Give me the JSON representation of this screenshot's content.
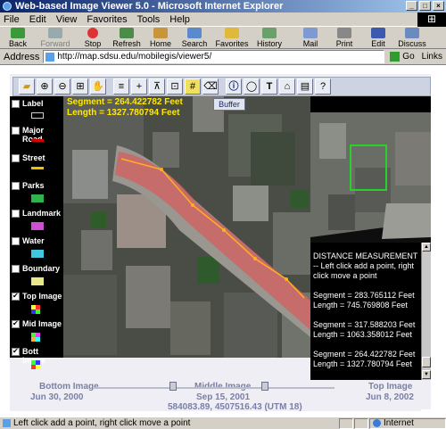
{
  "window": {
    "title": "Web-based Image Viewer 5.0 - Microsoft Internet Explorer"
  },
  "menu": [
    "File",
    "Edit",
    "View",
    "Favorites",
    "Tools",
    "Help"
  ],
  "toolbar": {
    "back": "Back",
    "forward": "Forward",
    "stop": "Stop",
    "refresh": "Refresh",
    "home": "Home",
    "search": "Search",
    "favorites": "Favorites",
    "history": "History",
    "mail": "Mail",
    "print": "Print",
    "edit": "Edit",
    "discuss": "Discuss"
  },
  "address": {
    "label": "Address",
    "url": "http://map.sdsu.edu/mobilegis/viewer5/",
    "go": "Go",
    "links": "Links"
  },
  "measurement": {
    "segment": "Segment = 264.422782 Feet",
    "length": "Length = 1327.780794 Feet"
  },
  "buffer_label": "Buffer",
  "legend": [
    {
      "label": "Label",
      "checked": false
    },
    {
      "label": "Major Road",
      "checked": false,
      "color": "#d40000"
    },
    {
      "label": "Street",
      "checked": false,
      "color": "#f0c000"
    },
    {
      "label": "Parks",
      "checked": false,
      "color": "#2fb34a"
    },
    {
      "label": "Landmark",
      "checked": false,
      "color": "#d04fd0"
    },
    {
      "label": "Water",
      "checked": false,
      "color": "#3fc8e0"
    },
    {
      "label": "Boundary",
      "checked": false,
      "color": "#e8e88a"
    },
    {
      "label": "Top Image",
      "checked": true
    },
    {
      "label": "Mid Image",
      "checked": true
    },
    {
      "label": "Bott Image",
      "checked": true
    }
  ],
  "panel_text": {
    "intro": "DISTANCE MEASUREMENT -- Left click add a point, right click move a point",
    "m1_seg": "Segment = 283.765112 Feet",
    "m1_len": "Length = 745.769808 Feet",
    "m2_seg": "Segment = 317.588203 Feet",
    "m2_len": "Length = 1063.358012 Feet",
    "m3_seg": "Segment = 264.422782 Feet",
    "m3_len": "Length = 1327.780794 Feet"
  },
  "timeline": {
    "bottom_label": "Bottom Image",
    "bottom_date": "Jun 30, 2000",
    "middle_label": "Middle Image",
    "middle_date": "Sep 15, 2001",
    "top_label": "Top Image",
    "top_date": "Jun 8, 2002",
    "coords": "584083.89, 4507516.43  (UTM 18)"
  },
  "status": {
    "message": "Left click add a point, right click move a point",
    "zone": "Internet"
  }
}
